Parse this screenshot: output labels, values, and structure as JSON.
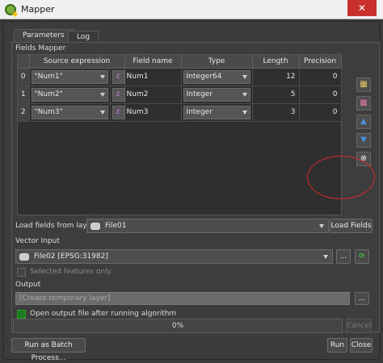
{
  "window": {
    "title": "Mapper",
    "close_glyph": "✕"
  },
  "tabs": [
    {
      "label": "Parameters",
      "active": true
    },
    {
      "label": "Log",
      "active": false
    }
  ],
  "fields_mapper": {
    "label": "Fields Mapper",
    "columns": [
      "Source expression",
      "Field name",
      "Type",
      "Length",
      "Precision"
    ],
    "rows": [
      {
        "index": "0",
        "source": "\"Num1\"",
        "name": "Num1",
        "type": "Integer64",
        "length": "12",
        "precision": "0"
      },
      {
        "index": "1",
        "source": "\"Num2\"",
        "name": "Num2",
        "type": "Integer",
        "length": "5",
        "precision": "0"
      },
      {
        "index": "2",
        "source": "\"Num3\"",
        "name": "Num3",
        "type": "Integer",
        "length": "3",
        "precision": "0"
      }
    ],
    "expression_glyph": "ε",
    "side_buttons": [
      {
        "name": "add-field-button",
        "glyph": "▦"
      },
      {
        "name": "delete-field-button",
        "glyph": "▦"
      },
      {
        "name": "move-up-button",
        "glyph": "▲"
      },
      {
        "name": "move-down-button",
        "glyph": "▼"
      },
      {
        "name": "reset-fields-button",
        "glyph": "⊗"
      }
    ]
  },
  "load_fields": {
    "label": "Load fields from layer",
    "layer": "File01",
    "button": "Load Fields"
  },
  "vector_input": {
    "label": "Vector Input",
    "layer": "File02 [EPSG:31982]",
    "browse": "...",
    "iterate_glyph": "⟳",
    "selected_only": "Selected features only"
  },
  "output": {
    "label": "Output",
    "placeholder": "[Create temporary layer]",
    "browse": "...",
    "open_after": "Open output file after running algorithm"
  },
  "progress": {
    "text": "0%",
    "value": 0
  },
  "buttons": {
    "cancel": "Cancel",
    "batch": "Run as Batch Process...",
    "run": "Run",
    "close": "Close"
  },
  "colors": {
    "accent_checkbox": "#1e7a1e",
    "annotation": "#d32a2a",
    "move_arrows": "#4a90d9"
  }
}
